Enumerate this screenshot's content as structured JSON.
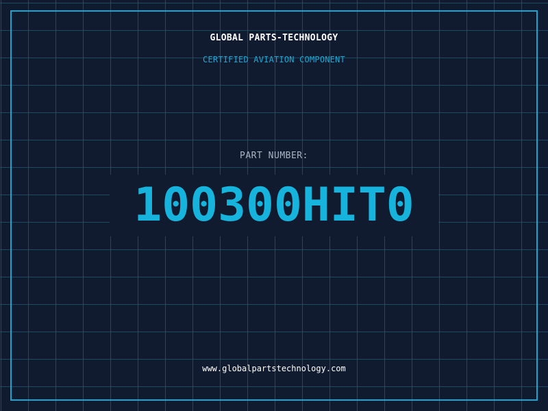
{
  "header": {
    "company": "GLOBAL PARTS-TECHNOLOGY",
    "subtitle": "CERTIFIED AVIATION COMPONENT"
  },
  "part": {
    "label": "PART NUMBER:",
    "number": "100300HIT0"
  },
  "footer": {
    "website": "www.globalpartstechnology.com"
  },
  "colors": {
    "background": "#111b30",
    "grid": "#1f4a63",
    "accent": "#17a6cf",
    "text": "#ffffff"
  }
}
